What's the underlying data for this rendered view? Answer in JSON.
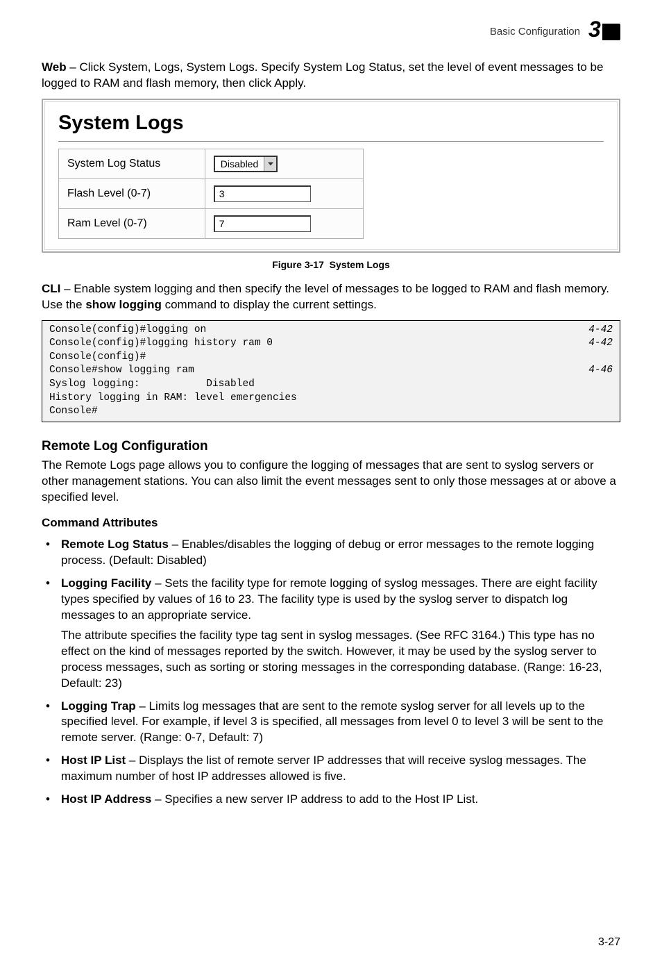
{
  "header": {
    "section_label": "Basic Configuration",
    "chapter_number": "3"
  },
  "intro": {
    "web_label": "Web",
    "web_text": " – Click System, Logs, System Logs. Specify System Log Status, set the level of event messages to be logged to RAM and flash memory, then click Apply."
  },
  "screenshot": {
    "title": "System Logs",
    "rows": {
      "status_label": "System Log Status",
      "status_value": "Disabled",
      "flash_label": "Flash Level (0-7)",
      "flash_value": "3",
      "ram_label": "Ram Level (0-7)",
      "ram_value": "7"
    }
  },
  "figure": {
    "number": "Figure 3-17",
    "title": "System Logs"
  },
  "cli_intro": {
    "cli_label": "CLI",
    "text1": " – Enable system logging and then specify the level of messages to be logged to RAM and flash memory. Use the ",
    "show_logging": "show logging",
    "text2": " command to display the current settings."
  },
  "cli": {
    "l1_cmd": "Console(config)#logging on",
    "l1_ref": "4-42",
    "l2_cmd": "Console(config)#logging history ram 0",
    "l2_ref": "4-42",
    "l3_cmd": "Console(config)#",
    "l4_cmd": "Console#show logging ram",
    "l4_ref": "4-46",
    "l5_cmd": "Syslog logging:           Disabled",
    "l6_cmd": "History logging in RAM: level emergencies",
    "l7_cmd": "Console#"
  },
  "remote": {
    "heading": "Remote Log Configuration",
    "desc": "The Remote Logs page allows you to configure the logging of messages that are sent to syslog servers or other management stations. You can also limit the event messages sent to only those messages at or above a specified level.",
    "command_attributes": "Command Attributes",
    "bullets": {
      "b1_label": "Remote Log Status",
      "b1_text": " – Enables/disables the logging of debug or error messages to the remote logging process. (Default: Disabled)",
      "b2_label": "Logging Facility",
      "b2_text": " – Sets the facility type for remote logging of syslog messages. There are eight facility types specified by values of 16 to 23. The facility type is used by the syslog server to dispatch log messages to an appropriate service.",
      "b2_extra": "The attribute specifies the facility type tag sent in syslog messages. (See RFC 3164.) This type has no effect on the kind of messages reported by the switch. However, it may be used by the syslog server to process messages, such as sorting or storing messages in the corresponding database. (Range: 16-23, Default: 23)",
      "b3_label": "Logging Trap",
      "b3_text": " – Limits log messages that are sent to the remote syslog server for all levels up to the specified level. For example, if level 3 is specified, all messages from level 0 to level 3 will be sent to the remote server. (Range: 0-7, Default: 7)",
      "b4_label": "Host IP List",
      "b4_text": " – Displays the list of remote server IP addresses that will receive syslog messages. The maximum number of host IP addresses allowed is five.",
      "b5_label": "Host IP Address",
      "b5_text": " – Specifies a new server IP address to add to the Host IP List."
    }
  },
  "page_number": "3-27"
}
